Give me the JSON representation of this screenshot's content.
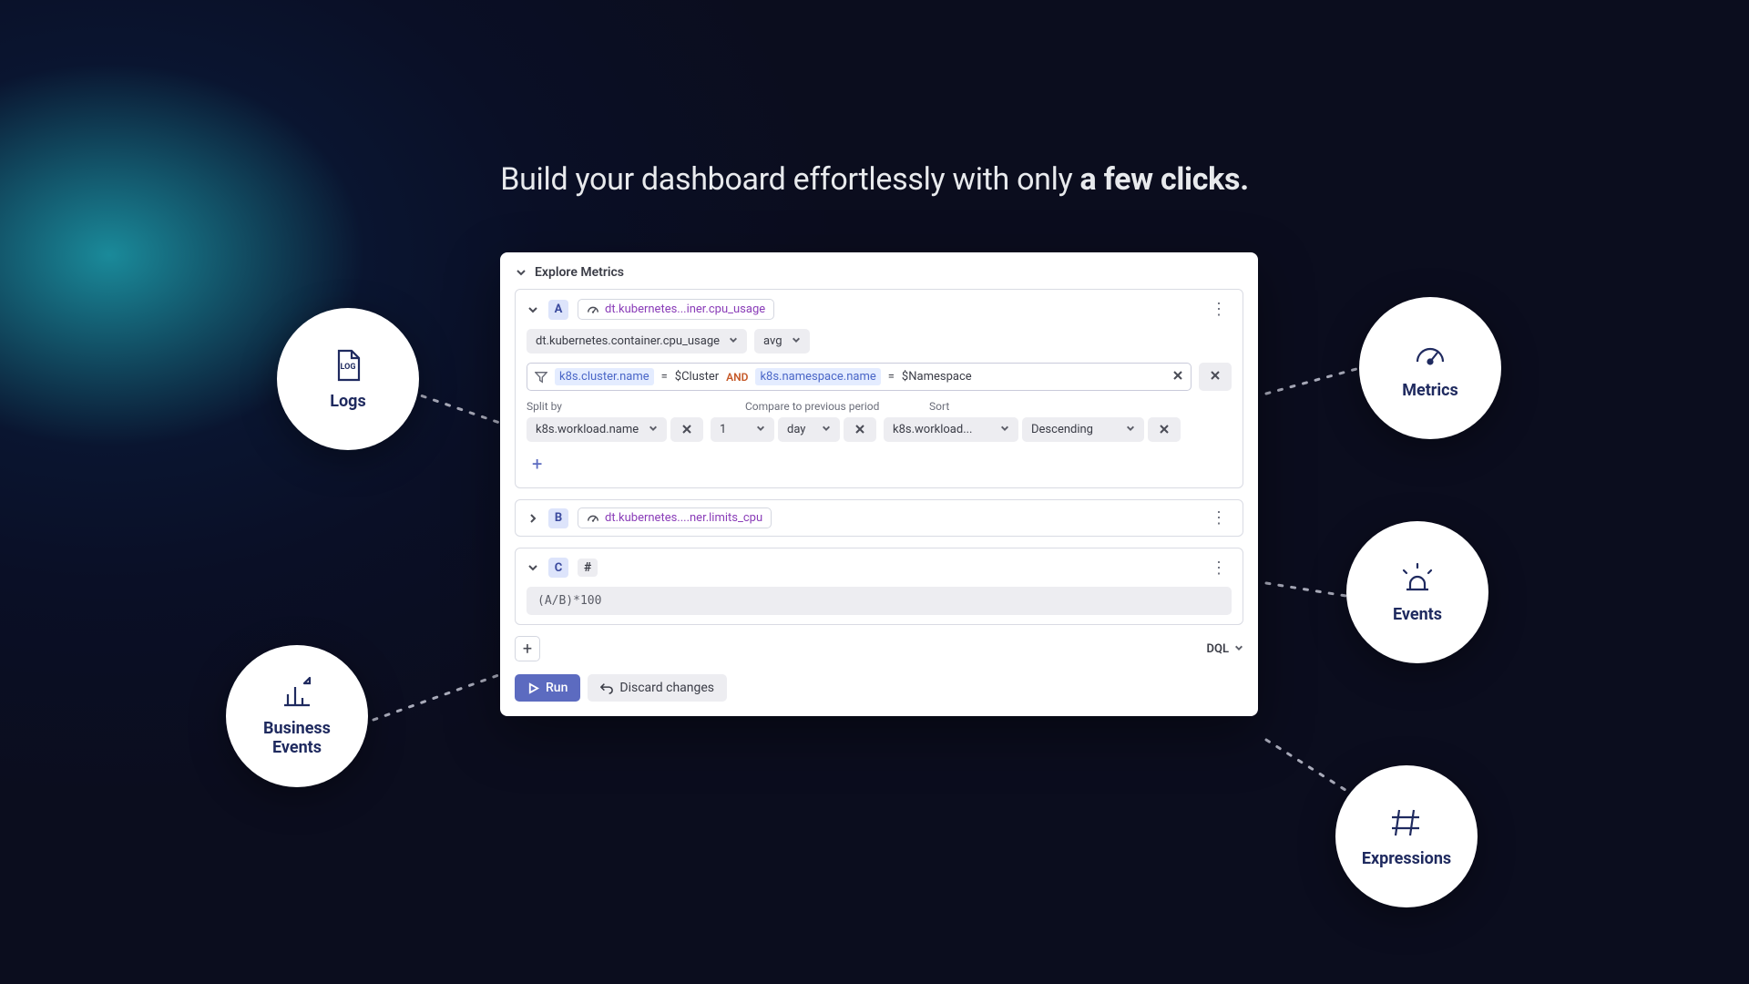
{
  "headline": {
    "prefix": "Build your dashboard effortlessly with only ",
    "bold": "a few clicks."
  },
  "panel": {
    "title": "Explore Metrics",
    "A": {
      "badge": "A",
      "metric_short": "dt.kubernetes...iner.cpu_usage",
      "metric_full": "dt.kubernetes.container.cpu_usage",
      "agg": "avg",
      "filter": {
        "k1": "k8s.cluster.name",
        "v1": "$Cluster",
        "and": "AND",
        "k2": "k8s.namespace.name",
        "v2": "$Namespace"
      },
      "labels": {
        "split": "Split by",
        "compare": "Compare to previous period",
        "sort": "Sort"
      },
      "split_field": "k8s.workload.name",
      "compare_n": "1",
      "compare_unit": "day",
      "sort_field": "k8s.workload...",
      "sort_dir": "Descending"
    },
    "B": {
      "badge": "B",
      "metric_short": "dt.kubernetes....ner.limits_cpu"
    },
    "C": {
      "badge": "C",
      "expr": "(A/B)*100"
    },
    "dql": "DQL",
    "run": "Run",
    "discard": "Discard changes"
  },
  "bubbles": {
    "logs": "Logs",
    "biz": "Business\nEvents",
    "metrics": "Metrics",
    "events": "Events",
    "expr": "Expressions"
  }
}
